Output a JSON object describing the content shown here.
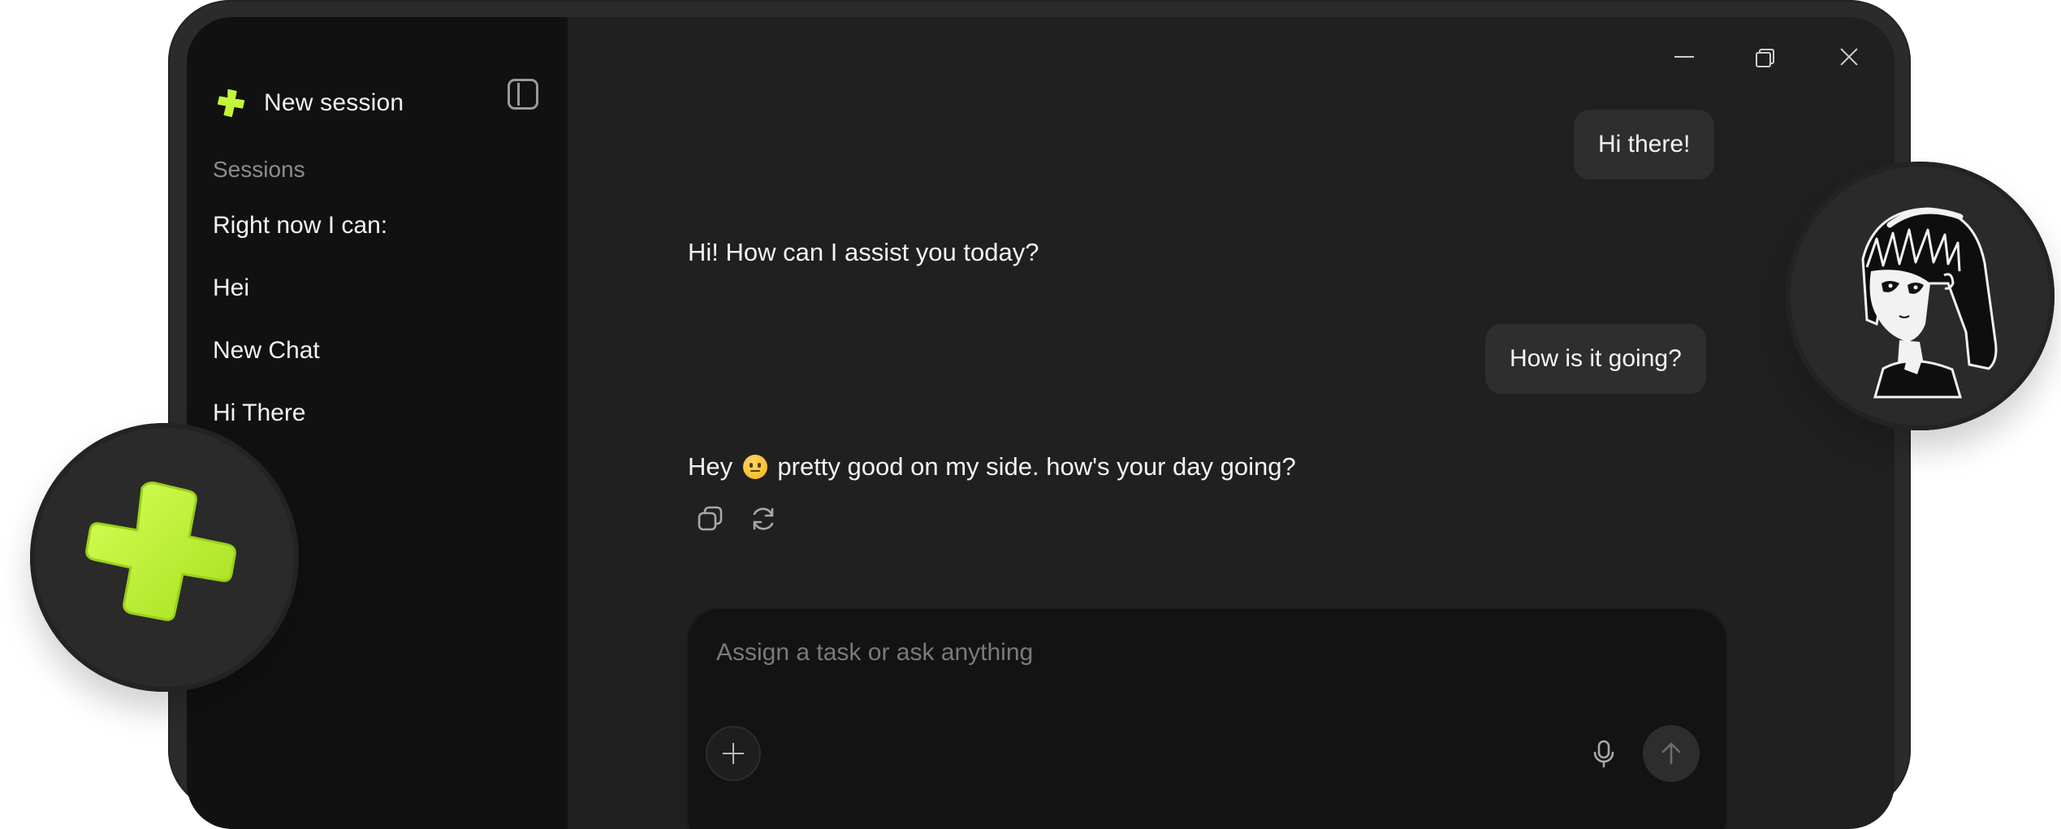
{
  "sidebar": {
    "new_session_label": "New session",
    "sessions_heading": "Sessions",
    "sessions": [
      {
        "label": "Right now I can:"
      },
      {
        "label": "Hei"
      },
      {
        "label": "New Chat"
      },
      {
        "label": "Hi There"
      }
    ]
  },
  "window_controls": [
    "minimize-icon",
    "restore-icon",
    "close-icon"
  ],
  "chat": {
    "messages": [
      {
        "role": "user",
        "text": "Hi there!"
      },
      {
        "role": "assistant",
        "text": "Hi! How can I assist you today?"
      },
      {
        "role": "user",
        "text": "How is it going?"
      },
      {
        "role": "assistant",
        "text_before_emoji": "Hey",
        "emoji": "slightly-smiling-face",
        "text_after_emoji": "pretty good on my side. how's your day going?"
      }
    ],
    "actions": [
      "copy-icon",
      "regenerate-icon"
    ]
  },
  "composer": {
    "placeholder": "Assign a task or ask anything"
  },
  "colors": {
    "accent": "#c2f53c",
    "sidebar_bg": "#111111",
    "main_bg": "#202020",
    "bubble_bg": "#2e2e2e"
  }
}
